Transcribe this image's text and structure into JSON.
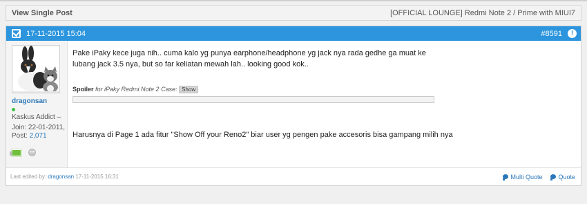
{
  "topbar": {
    "title": "View Single Post",
    "thread": "[OFFICIAL LOUNGE] Redmi Note 2 / Prime with MIUI7"
  },
  "post": {
    "datetime": "17-11-2015 15:04",
    "number": "#8591",
    "alert_glyph": "!",
    "user": {
      "name": "dragonsan",
      "title": "Kaskus Addict –",
      "join": "Join: 22-01-2011,",
      "posts_label": "Post:",
      "posts": "2,071",
      "online_color": "#3cc13c"
    },
    "content": {
      "paragraph1": "Pake iPaky kece juga nih.. cuma kalo yg punya earphone/headphone yg jack nya rada gedhe ga muat ke lubang jack 3.5 nya, but so far keliatan mewah lah.. looking good kok..",
      "spoiler_label": "Spoiler",
      "spoiler_for": "for iPaky Redmi Note 2 Case:",
      "spoiler_button": "Show",
      "paragraph2": "Harusnya di Page 1 ada fitur \"Show Off your Reno2\" biar user yg pengen pake accesoris bisa gampang milih nya"
    },
    "footer": {
      "edited_label": "Last edited by:",
      "editor": "dragonsan",
      "edited_time": "17-11-2015 16:31",
      "multi_quote": "Multi Quote",
      "quote": "Quote"
    }
  },
  "colors": {
    "header_bg": "#2c95dd",
    "link": "#2b77b9"
  }
}
